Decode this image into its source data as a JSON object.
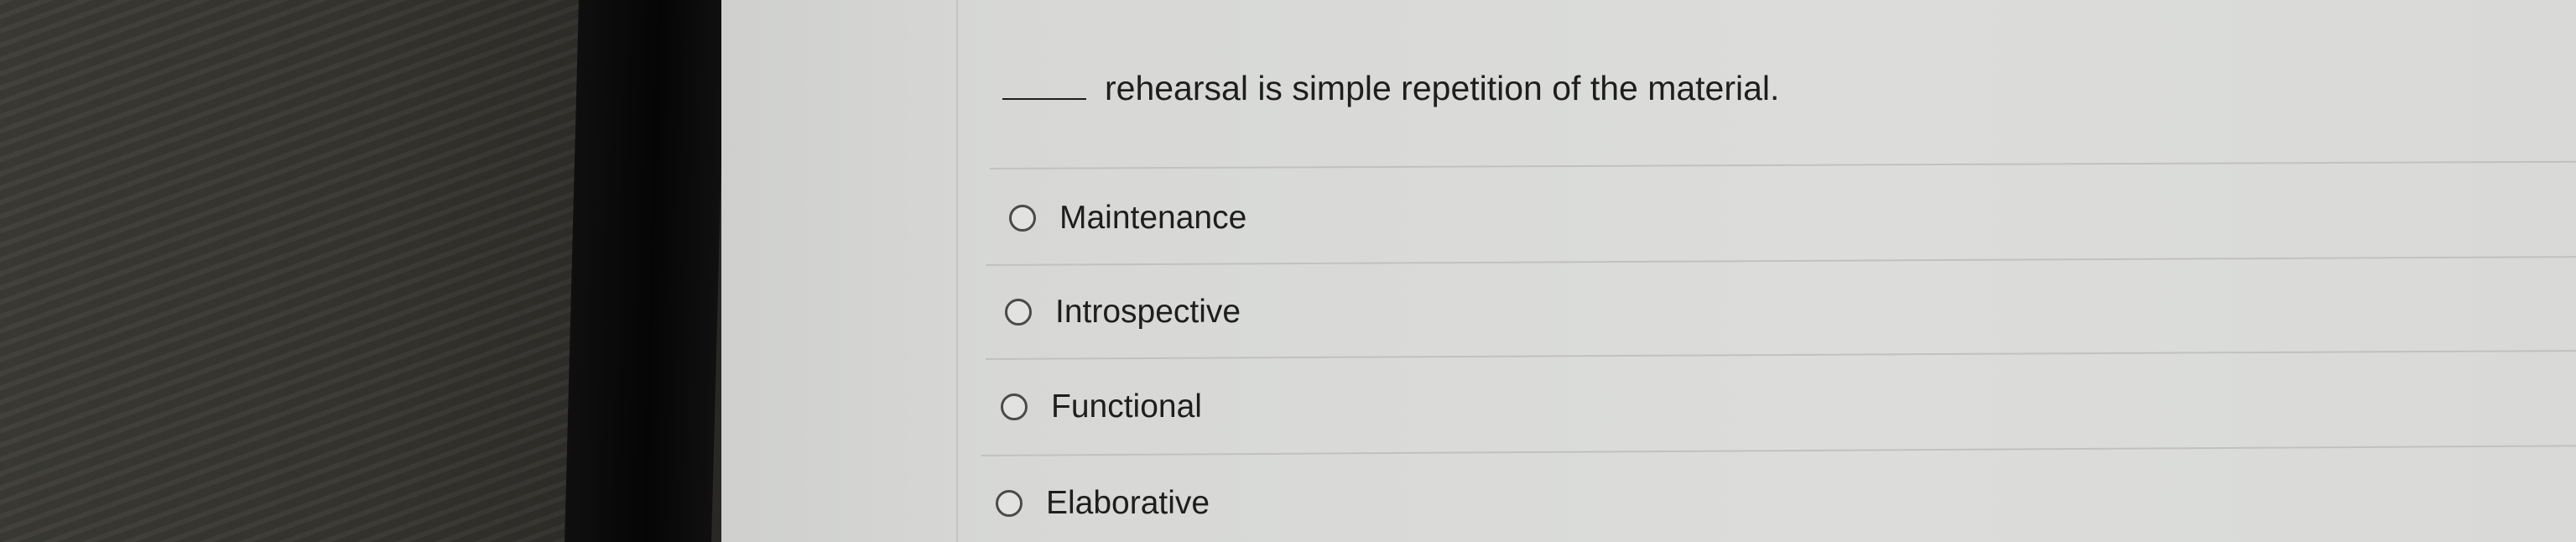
{
  "question": {
    "text": "rehearsal is simple repetition of the material."
  },
  "options": [
    {
      "label": "Maintenance"
    },
    {
      "label": "Introspective"
    },
    {
      "label": "Functional"
    },
    {
      "label": "Elaborative"
    }
  ]
}
